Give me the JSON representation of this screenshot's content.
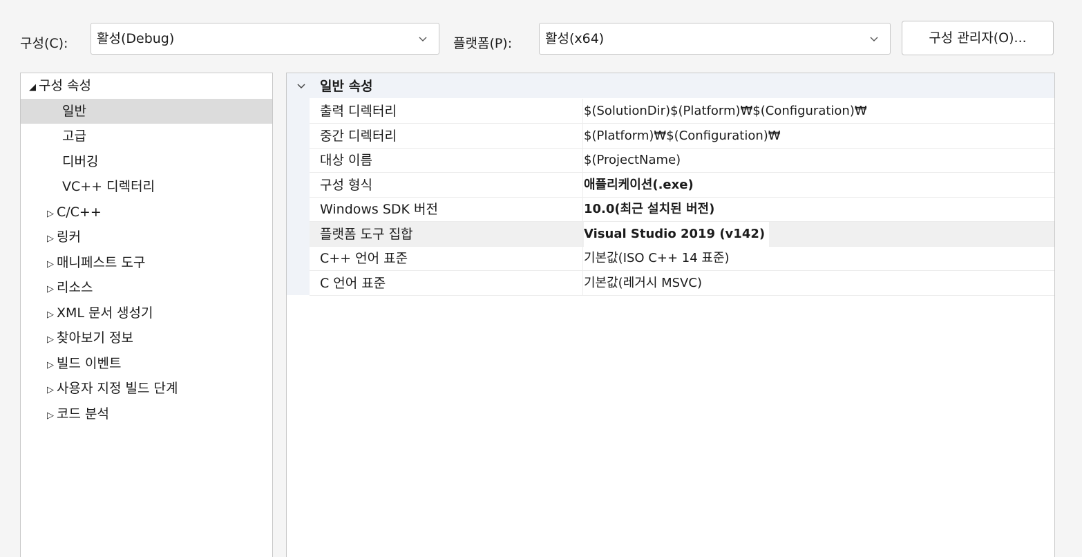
{
  "toolbar": {
    "config_label": "구성(C):",
    "config_value": "활성(Debug)",
    "platform_label": "플랫폼(P):",
    "platform_value": "활성(x64)",
    "config_manager_button": "구성 관리자(O)..."
  },
  "tree": {
    "root": "구성 속성",
    "items": [
      {
        "label": "일반",
        "expandable": false,
        "selected": true
      },
      {
        "label": "고급",
        "expandable": false
      },
      {
        "label": "디버깅",
        "expandable": false
      },
      {
        "label": "VC++ 디렉터리",
        "expandable": false
      },
      {
        "label": "C/C++",
        "expandable": true
      },
      {
        "label": "링커",
        "expandable": true
      },
      {
        "label": "매니페스트 도구",
        "expandable": true
      },
      {
        "label": "리소스",
        "expandable": true
      },
      {
        "label": "XML 문서 생성기",
        "expandable": true
      },
      {
        "label": "찾아보기 정보",
        "expandable": true
      },
      {
        "label": "빌드 이벤트",
        "expandable": true
      },
      {
        "label": "사용자 지정 빌드 단계",
        "expandable": true
      },
      {
        "label": "코드 분석",
        "expandable": true
      }
    ]
  },
  "grid": {
    "section_title": "일반 속성",
    "rows": [
      {
        "name": "출력 디렉터리",
        "value": "$(SolutionDir)$(Platform)₩$(Configuration)₩",
        "bold": false
      },
      {
        "name": "중간 디렉터리",
        "value": "$(Platform)₩$(Configuration)₩",
        "bold": false
      },
      {
        "name": "대상 이름",
        "value": "$(ProjectName)",
        "bold": false
      },
      {
        "name": "구성 형식",
        "value": "애플리케이션(.exe)",
        "bold": true
      },
      {
        "name": "Windows SDK 버전",
        "value": "10.0(최근 설치된 버전)",
        "bold": true
      },
      {
        "name": "플랫폼 도구 집합",
        "value": "Visual Studio 2019 (v142)",
        "bold": true,
        "selected": true
      },
      {
        "name": "C++ 언어 표준",
        "value": "기본값(ISO C++ 14 표준)",
        "bold": false
      },
      {
        "name": "C 언어 표준",
        "value": "기본값(레거시 MSVC)",
        "bold": false
      }
    ]
  }
}
